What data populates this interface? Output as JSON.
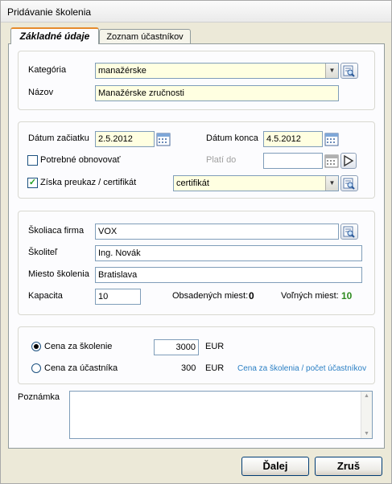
{
  "window": {
    "title": "Pridávanie školenia"
  },
  "tabs": [
    {
      "label": "Základné údaje",
      "active": true
    },
    {
      "label": "Zoznam účastníkov",
      "active": false
    }
  ],
  "basic": {
    "category_label": "Kategória",
    "category_value": "manažérske",
    "name_label": "Názov",
    "name_value": "Manažérske zručnosti"
  },
  "dates": {
    "start_label": "Dátum začiatku",
    "start_value": "2.5.2012",
    "end_label": "Dátum konca",
    "end_value": "4.5.2012",
    "renew_label": "Potrebné obnovovať",
    "renew_checked": false,
    "valid_until_label": "Platí do",
    "valid_until_value": "",
    "certificate_label": "Získa preukaz / certifikát",
    "certificate_checked": true,
    "certificate_type": "certifikát"
  },
  "provider": {
    "company_label": "Školiaca firma",
    "company_value": "VOX",
    "trainer_label": "Školiteľ",
    "trainer_value": "Ing. Novák",
    "place_label": "Miesto školenia",
    "place_value": "Bratislava",
    "capacity_label": "Kapacita",
    "capacity_value": "10",
    "occupied_label": "Obsadených miest:",
    "occupied_value": "0",
    "free_label": "Voľných miest:",
    "free_value": "10"
  },
  "price": {
    "per_training_label": "Cena za školenie",
    "per_training_value": "3000",
    "per_training_currency": "EUR",
    "per_participant_label": "Cena za účastníka",
    "per_participant_value": "300",
    "per_participant_currency": "EUR",
    "formula_link": "Cena za školenia / počet účastníkov",
    "selected": "per_training"
  },
  "note": {
    "label": "Poznámka",
    "value": ""
  },
  "footer": {
    "next_label": "Ďalej",
    "cancel_label": "Zruš"
  },
  "colors": {
    "tab_highlight": "#e68b2c",
    "free_count": "#2e8b1f",
    "link": "#2a7fc4",
    "required_field": "#ffffe1"
  }
}
